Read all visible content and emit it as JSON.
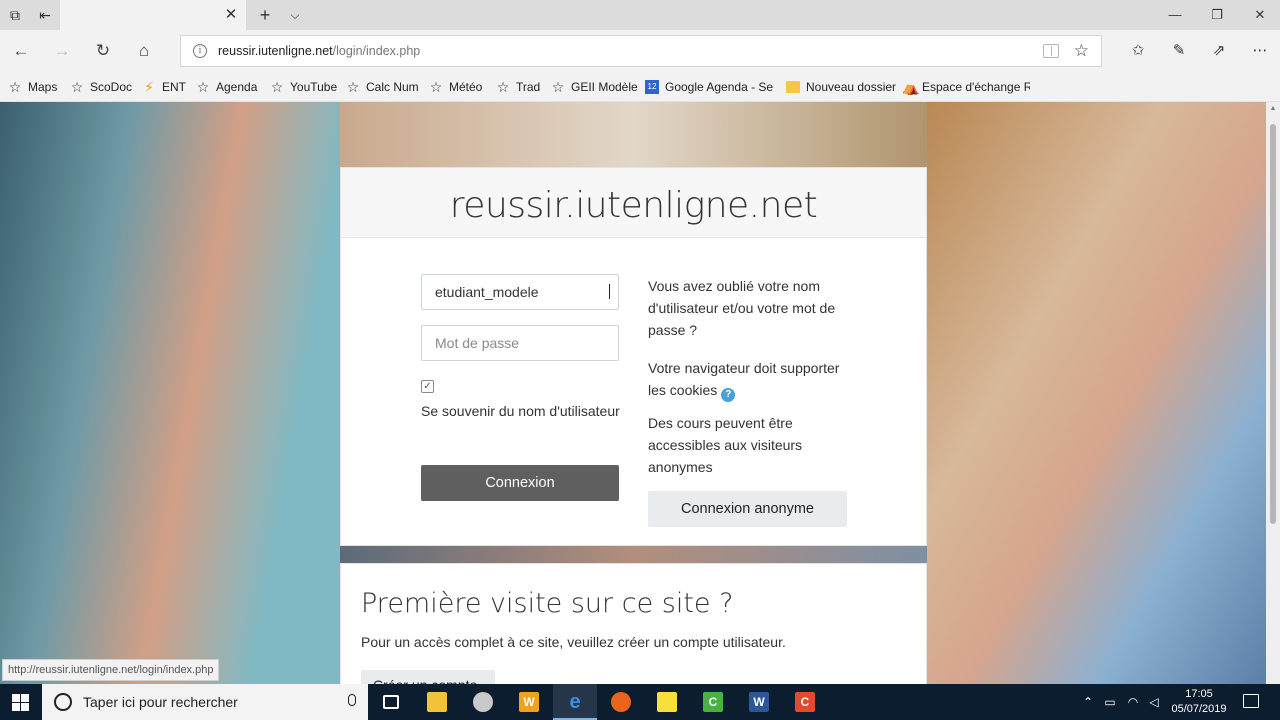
{
  "browser": {
    "url_host": "reussir.iutenligne.net",
    "url_path": "/login/index.php",
    "favorites": [
      {
        "label": "Maps",
        "icon": "star-icon"
      },
      {
        "label": "ScoDoc",
        "icon": "star-icon"
      },
      {
        "label": "ENT",
        "icon": "ent-icon"
      },
      {
        "label": "Agenda",
        "icon": "star-icon"
      },
      {
        "label": "YouTube",
        "icon": "star-icon"
      },
      {
        "label": "Calc Num",
        "icon": "star-icon"
      },
      {
        "label": "Météo",
        "icon": "star-icon"
      },
      {
        "label": "Trad",
        "icon": "star-icon"
      },
      {
        "label": "GEII Modèle",
        "icon": "star-icon"
      },
      {
        "label": "Google Agenda - Sen",
        "icon": "calendar-icon",
        "badge": "12"
      },
      {
        "label": "Nouveau dossier",
        "icon": "folder-icon"
      },
      {
        "label": "Espace d'échange Rel",
        "icon": "espace-icon"
      }
    ],
    "status_url": "http://reussir.iutenligne.net/login/index.php"
  },
  "login": {
    "site_title": "reussir.iutenligne.net",
    "username_value": "etudiant_modele",
    "password_placeholder": "Mot de passe",
    "remember_label": "Se souvenir du nom d'utilisateur",
    "remember_checked": true,
    "login_button": "Connexion",
    "forgot_text": "Vous avez oublié votre nom d'utilisateur et/ou votre mot de passe ?",
    "cookies_text": "Votre navigateur doit supporter les cookies",
    "guest_text": "Des cours peuvent être accessibles aux visiteurs anonymes",
    "guest_button": "Connexion anonyme"
  },
  "first_visit": {
    "title": "Première visite sur ce site ?",
    "text": "Pour un accès complet à ce site, veuillez créer un compte utilisateur.",
    "button": "Créer un compte"
  },
  "taskbar": {
    "search_placeholder": "Taper ici pour rechercher",
    "apps": [
      "task-view",
      "file-explorer",
      "chrome-like",
      "word-w",
      "edge",
      "firefox",
      "sticky-notes",
      "camtasia",
      "word",
      "camtasia-recorder"
    ],
    "time": "17:05",
    "date": "05/07/2019"
  },
  "colors": {
    "login_button_bg": "#5f5f5f",
    "secondary_button_bg": "#e9ecef",
    "help_badge": "#47a0d8",
    "taskbar_bg": "#0c1d30"
  }
}
